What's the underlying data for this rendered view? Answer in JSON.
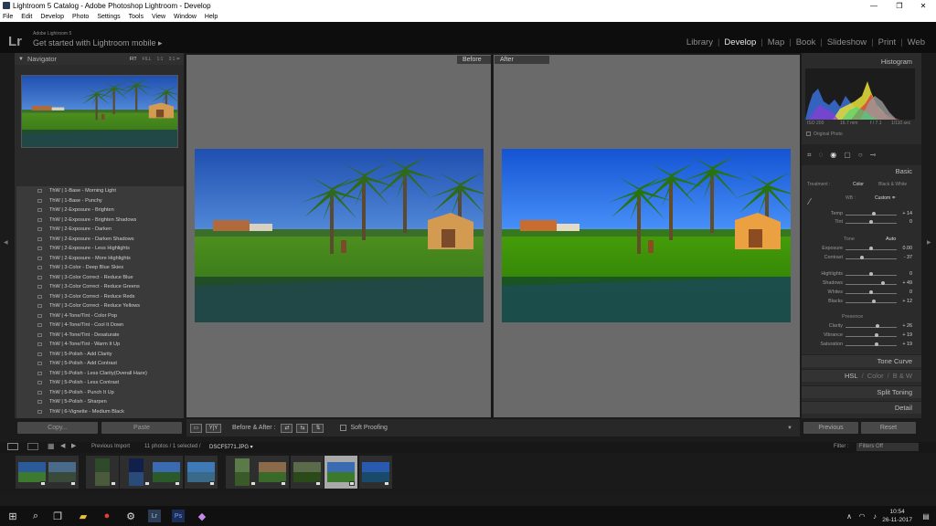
{
  "window": {
    "title": "Lightroom 5 Catalog - Adobe Photoshop Lightroom - Develop",
    "minimize": "—",
    "maximize": "❐",
    "close": "✕"
  },
  "menu": [
    "File",
    "Edit",
    "Develop",
    "Photo",
    "Settings",
    "Tools",
    "View",
    "Window",
    "Help"
  ],
  "identity": {
    "logo": "Lr",
    "product": "Adobe Lightroom 5",
    "tagline": "Get started with Lightroom mobile ▸"
  },
  "modules": {
    "library": "Library",
    "develop": "Develop",
    "map": "Map",
    "book": "Book",
    "slideshow": "Slideshow",
    "print": "Print",
    "web": "Web"
  },
  "navigator": {
    "title": "Navigator",
    "zoom": [
      "FIT",
      "FILL",
      "1:1",
      "3:1 ≑"
    ]
  },
  "presets": [
    "ThW | 1-Base - Morning Light",
    "ThW | 1-Base - Punchy",
    "ThW | 2-Exposure - Brighten",
    "ThW | 2-Exposure - Brighten Shadows",
    "ThW | 2-Exposure - Darken",
    "ThW | 2-Exposure - Darken Shadows",
    "ThW | 2-Exposure - Less Highlights",
    "ThW | 2-Exposure - More Highlights",
    "ThW | 3-Color - Deep Blue Skies",
    "ThW | 3-Color Correct - Reduce Blue",
    "ThW | 3-Color Correct - Reduce Greens",
    "ThW | 3-Color Correct - Reduce Reds",
    "ThW | 3-Color Correct - Reduce Yellows",
    "ThW | 4-Tone/Tint - Color Pop",
    "ThW | 4-Tone/Tint - Cool It Down",
    "ThW | 4-Tone/Tint - Desaturate",
    "ThW | 4-Tone/Tint - Warm It Up",
    "ThW | 5-Polish - Add Clarity",
    "ThW | 5-Polish - Add Contrast",
    "ThW | 5-Polish - Less Clarity(Overall Haze)",
    "ThW | 5-Polish - Less Contrast",
    "ThW | 5-Polish - Punch It Up",
    "ThW | 5-Polish - Sharpen",
    "ThW | 6-Vignette - Medium Black"
  ],
  "left_buttons": {
    "copy": "Copy...",
    "paste": "Paste"
  },
  "view": {
    "before": "Before",
    "after": "After"
  },
  "toolbar": {
    "yy": "Y|Y",
    "before_after": "Before & After :",
    "soft_proofing": "Soft Proofing"
  },
  "histogram": {
    "title": "Histogram",
    "iso": "ISO 200",
    "focal": "16.7 mm",
    "aperture": "f / 7.1",
    "shutter": "1/110 sec",
    "original": "Original Photo"
  },
  "basic": {
    "title": "Basic",
    "treatment_label": "Treatment :",
    "color": "Color",
    "bw": "Black & White",
    "wb_label": "WB :",
    "wb_value": "Custom ≑",
    "tone": "Tone",
    "auto": "Auto",
    "presence": "Presence",
    "sliders": [
      {
        "label": "Temp",
        "value": "+ 14",
        "pos": 0.55
      },
      {
        "label": "Tint",
        "value": "0",
        "pos": 0.5
      },
      {
        "label": "Exposure",
        "value": "0.00",
        "pos": 0.5
      },
      {
        "label": "Contrast",
        "value": "- 37",
        "pos": 0.32
      },
      {
        "label": "Highlights",
        "value": "0",
        "pos": 0.5
      },
      {
        "label": "Shadows",
        "value": "+ 49",
        "pos": 0.74
      },
      {
        "label": "Whites",
        "value": "0",
        "pos": 0.5
      },
      {
        "label": "Blacks",
        "value": "+ 12",
        "pos": 0.56
      },
      {
        "label": "Clarity",
        "value": "+ 26",
        "pos": 0.63
      },
      {
        "label": "Vibrance",
        "value": "+ 19",
        "pos": 0.6
      },
      {
        "label": "Saturation",
        "value": "+ 19",
        "pos": 0.6
      }
    ]
  },
  "sections": {
    "tone_curve": "Tone Curve",
    "hsl": "HSL",
    "color": "Color",
    "bw": "B & W",
    "split_toning": "Split Toning",
    "detail": "Detail"
  },
  "right_buttons": {
    "previous": "Previous",
    "reset": "Reset"
  },
  "filmstrip": {
    "previous_import": "Previous Import",
    "count": "11 photos / 1 selected /",
    "filename": "DSCF5771.JPG ▾",
    "filter_label": "Filter :",
    "filter_value": "Filters Off"
  },
  "taskbar": {
    "time": "10:54",
    "date": "26-11-2017"
  },
  "colors": {
    "accent": "#d6d6d6",
    "panel": "#2b2b2b",
    "background": "#6a6a6a"
  }
}
